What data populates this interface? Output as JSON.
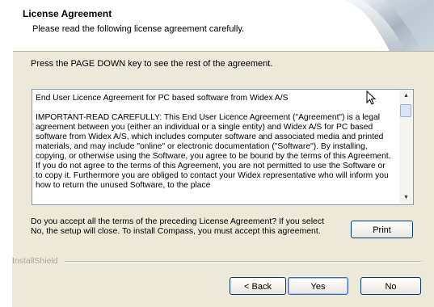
{
  "header": {
    "title": "License Agreement",
    "subtitle": "Please read the following license agreement carefully."
  },
  "instruction": "Press the PAGE DOWN key to see the rest of the agreement.",
  "license_text": "End User Licence Agreement for PC based software from Widex A/S\n\nIMPORTANT-READ CAREFULLY: This End User Licence Agreement (\"Agreement\") is a legal agreement between you (either an individual or a single entity) and Widex A/S for PC based software from Widex A/S, which includes computer software and associated media and printed materials, and may include \"online\" or electronic documentation (\"Software\"). By installing, copying, or otherwise using the Software, you agree to be bound by the terms of this Agreement. If you do not agree to the terms of this Agreement, you are not permitted to use the Software or to copy it. Furthermore you are obliged to contact your Widex representative who will inform you how to return the unused Software, to the place",
  "question": "Do you accept all the terms of the preceding License Agreement?  If you select No,  the setup will close.  To install Compass, you must accept this agreement.",
  "buttons": {
    "print": "Print",
    "back": "< Back",
    "yes": "Yes",
    "no": "No"
  },
  "brand": "InstallShield",
  "icons": {
    "scroll_up": "scroll-up-arrow",
    "scroll_down": "scroll-down-arrow",
    "cursor": "mouse-pointer"
  }
}
